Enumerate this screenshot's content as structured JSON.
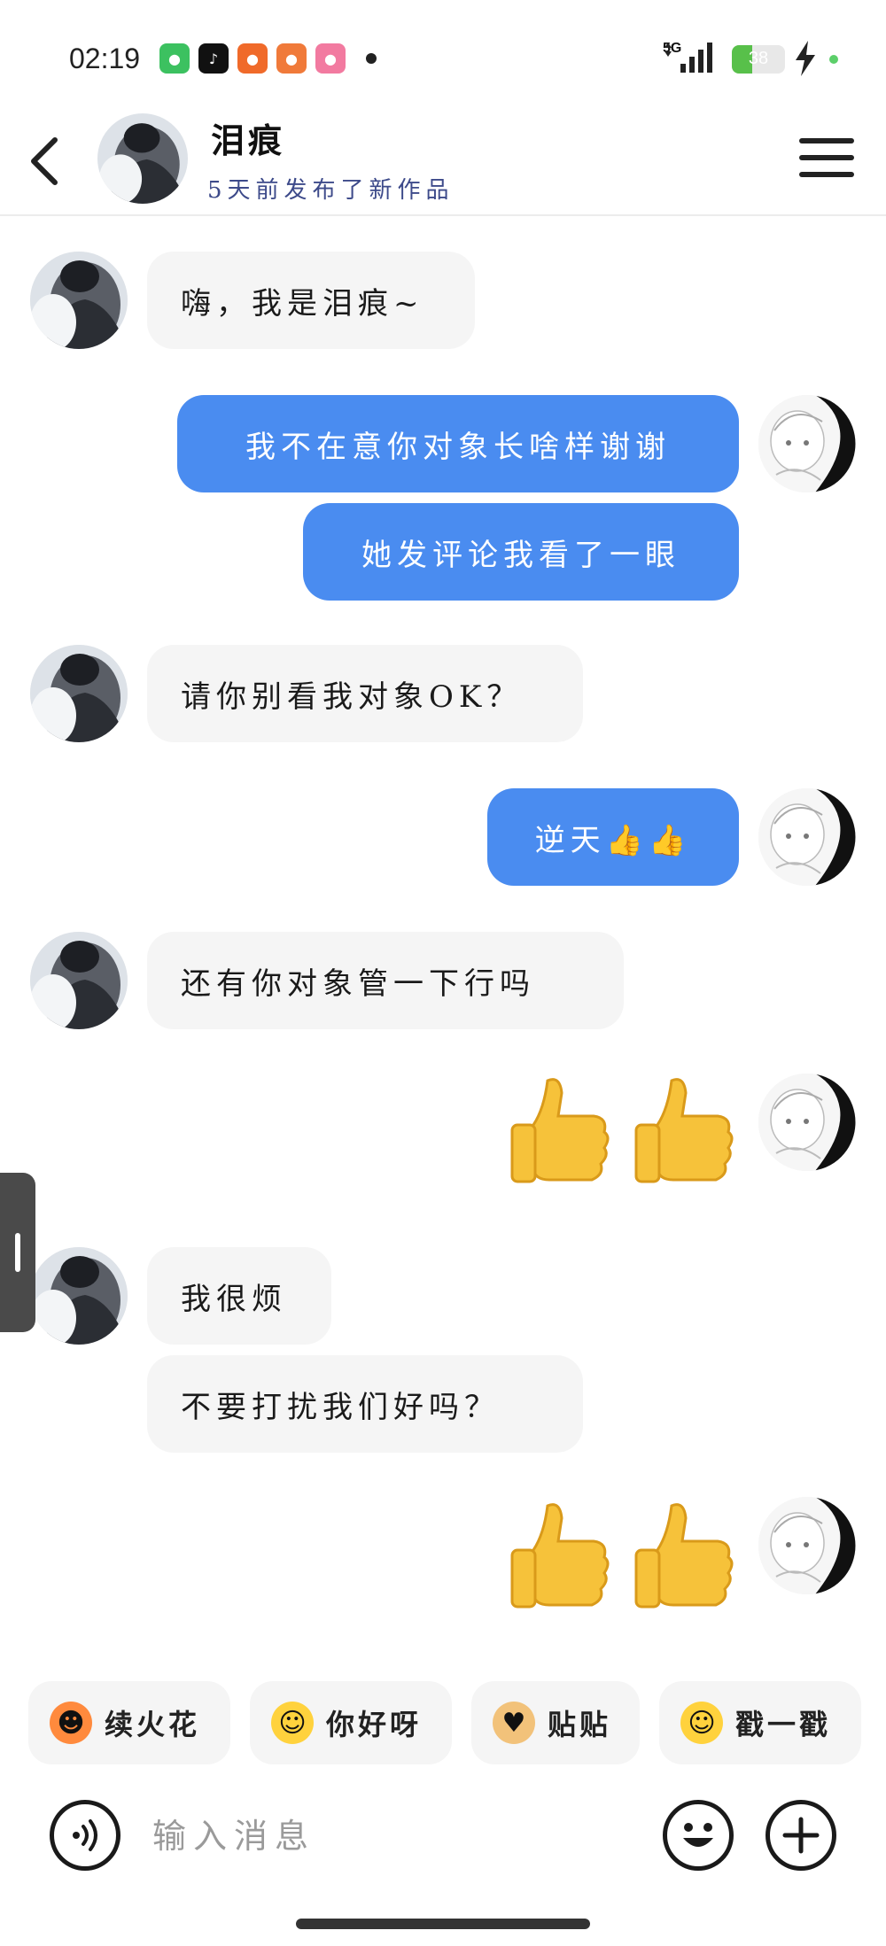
{
  "status_bar": {
    "time": "02:19",
    "network": "5G",
    "battery": "38",
    "battery_level": 0.38
  },
  "header": {
    "contact_name": "泪痕",
    "contact_status": "5天前发布了新作品"
  },
  "messages": [
    {
      "from": "them",
      "text": "嗨，我是泪痕~"
    },
    {
      "from": "me",
      "text": "我不在意你对象长啥样谢谢"
    },
    {
      "from": "me",
      "text": "她发评论我看了一眼"
    },
    {
      "from": "them",
      "text": "请你别看我对象OK？"
    },
    {
      "from": "me",
      "text": "逆天👍👍"
    },
    {
      "from": "them",
      "text": "还有你对象管一下行吗"
    },
    {
      "from": "me",
      "text": "👍👍"
    },
    {
      "from": "them",
      "text": "我很烦"
    },
    {
      "from": "them",
      "text": "不要打扰我们好吗？"
    },
    {
      "from": "me",
      "text": "👍👍"
    }
  ],
  "quick_replies": [
    {
      "label": "续火花",
      "icon": "fire-face-icon"
    },
    {
      "label": "你好呀",
      "icon": "laughing-face-icon"
    },
    {
      "label": "贴贴",
      "icon": "dog-hug-icon"
    },
    {
      "label": "戳一戳",
      "icon": "smirk-face-icon"
    }
  ],
  "input": {
    "placeholder": "输入消息"
  },
  "colors": {
    "outgoing_bubble": "#4a8cf0",
    "incoming_bubble": "#f5f5f5",
    "status_link": "#3d4a8a"
  }
}
